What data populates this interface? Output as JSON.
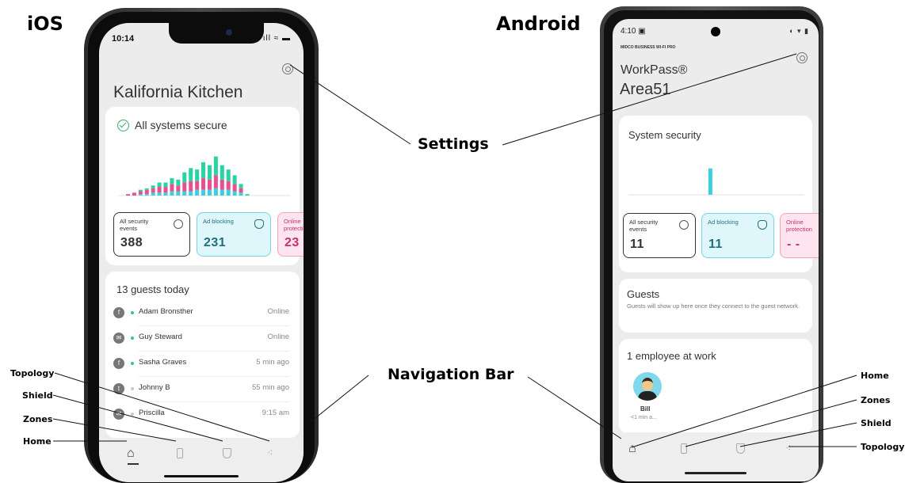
{
  "labels": {
    "ios": "iOS",
    "android": "Android",
    "settings": "Settings",
    "navigation_bar": "Navigation Bar",
    "left_nav": [
      "Topology",
      "Shield",
      "Zones",
      "Home"
    ],
    "right_nav": [
      "Home",
      "Zones",
      "Shield",
      "Topology"
    ]
  },
  "ios": {
    "status": {
      "time": "10:14",
      "icons": "ıll ≈ ▬"
    },
    "title": "Kalifornia Kitchen",
    "security": {
      "status": "All systems secure",
      "chart_data": {
        "type": "bar",
        "stacked": true,
        "colors": [
          "#3ccfe0",
          "#ea4f8f",
          "#2ad3a3"
        ],
        "ylim": [
          0,
          35
        ],
        "values_cyan": [
          0,
          0,
          1,
          1,
          2,
          2,
          2,
          3,
          3,
          3,
          3,
          4,
          4,
          4,
          5,
          4,
          4,
          3,
          2,
          0,
          0,
          0,
          0,
          0,
          0
        ],
        "values_pink": [
          1,
          2,
          2,
          3,
          3,
          4,
          4,
          5,
          4,
          6,
          7,
          6,
          8,
          7,
          9,
          7,
          6,
          5,
          3,
          0,
          0,
          0,
          0,
          0,
          0
        ],
        "values_green": [
          0,
          0,
          1,
          1,
          2,
          3,
          3,
          4,
          4,
          7,
          9,
          8,
          11,
          10,
          13,
          10,
          8,
          6,
          3,
          1,
          0,
          0,
          0,
          0,
          0
        ]
      },
      "tiles": [
        {
          "label": "All security events",
          "value": "388"
        },
        {
          "label": "Ad blocking",
          "value": "231"
        },
        {
          "label": "Online protection",
          "value": "23"
        }
      ]
    },
    "guests": {
      "title": "13 guests today",
      "rows": [
        {
          "icon": "f",
          "name": "Adam Bronsther",
          "status": "Online",
          "online": true
        },
        {
          "icon": "✉",
          "name": "Guy Steward",
          "status": "Online",
          "online": true
        },
        {
          "icon": "f",
          "name": "Sasha Graves",
          "status": "5 min ago",
          "online": true
        },
        {
          "icon": "t",
          "name": "Johnny B",
          "status": "55 min ago",
          "online": false
        },
        {
          "icon": "✉",
          "name": "Priscilla",
          "status": "9:15 am",
          "online": false
        }
      ]
    }
  },
  "android": {
    "status": {
      "time": "4:10 ▣",
      "icons": "◐ ▾ ▮"
    },
    "brand_small": "MIDCO BUSINESS WI-FI PRO",
    "brand": "WorkPass®",
    "network": "Area51",
    "security": {
      "title": "System security",
      "chart_data": {
        "type": "bar",
        "colors": [
          "#3ccfe0"
        ],
        "values": [
          0,
          0,
          0,
          0,
          0,
          0,
          0,
          0,
          0,
          10,
          0,
          0,
          0,
          0,
          0,
          0,
          0,
          0,
          0,
          0
        ],
        "ylim": [
          0,
          15
        ]
      },
      "tiles": [
        {
          "label": "All security events",
          "value": "11"
        },
        {
          "label": "Ad blocking",
          "value": "11"
        },
        {
          "label": "Online protection",
          "value": "- -"
        }
      ]
    },
    "guests": {
      "title": "Guests",
      "subtitle": "Guests will show up here once they connect to the guest network."
    },
    "employees": {
      "title": "1 employee at work",
      "name": "Bill",
      "time": "<1 min a..."
    }
  }
}
